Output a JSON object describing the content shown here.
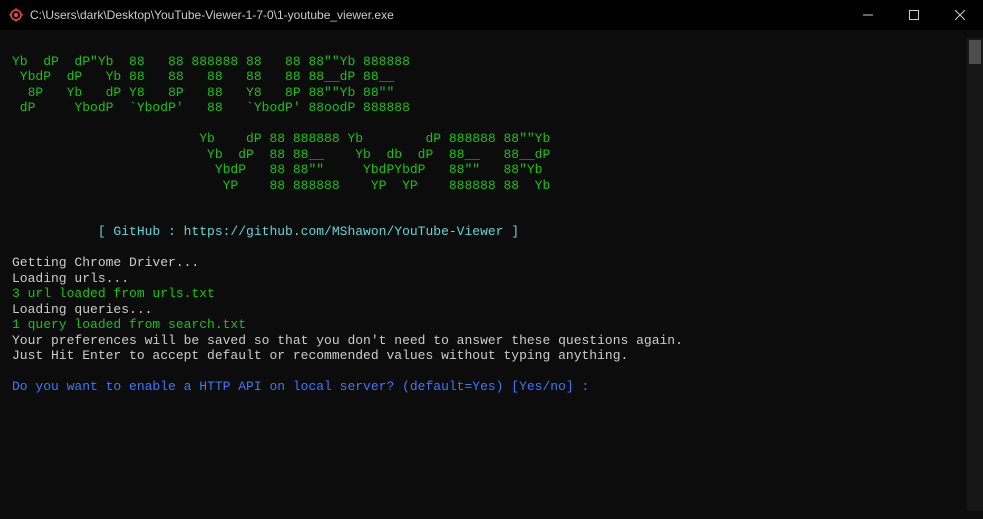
{
  "window": {
    "title": "C:\\Users\\dark\\Desktop\\YouTube-Viewer-1-7-0\\1-youtube_viewer.exe"
  },
  "ascii": {
    "line1": "Yb  dP  dP\"Yb  88   88 888888 88   88 88\"\"Yb 888888",
    "line2": " YbdP  dP   Yb 88   88   88   88   88 88__dP 88__",
    "line3": "  8P   Yb   dP Y8   8P   88   Y8   8P 88\"\"Yb 88\"\"",
    "line4": " dP     YbodP  `YbodP'   88   `YbodP' 88oodP 888888",
    "line5": "                        Yb    dP 88 888888 Yb        dP 888888 88\"\"Yb",
    "line6": "                         Yb  dP  88 88__    Yb  db  dP  88__   88__dP",
    "line7": "                          YbdP   88 88\"\"     YbdPYbdP   88\"\"   88\"Yb",
    "line8": "                           YP    88 888888    YP  YP    888888 88  Yb"
  },
  "github": {
    "text": "           [ GitHub : https://github.com/MShawon/YouTube-Viewer ]"
  },
  "log": {
    "line1": "Getting Chrome Driver...",
    "line2": "Loading urls...",
    "line3": "3 url loaded from urls.txt",
    "line4": "Loading queries...",
    "line5": "1 query loaded from search.txt",
    "line6": "Your preferences will be saved so that you don't need to answer these questions again.",
    "line7": "Just Hit Enter to accept default or recommended values without typing anything."
  },
  "prompt": {
    "text": "Do you want to enable a HTTP API on local server? (default=Yes) [Yes/no] : "
  }
}
